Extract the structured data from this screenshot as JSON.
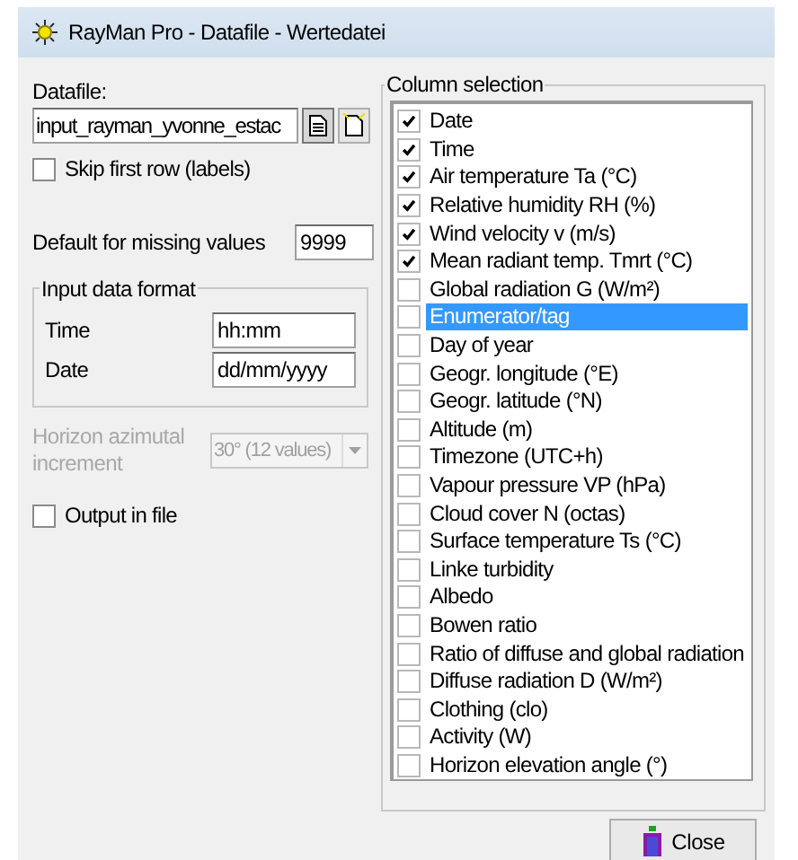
{
  "window": {
    "title": "RayMan Pro - Datafile - Wertedatei"
  },
  "datafile": {
    "label": "Datafile:",
    "value": "input_rayman_yvonne_estac"
  },
  "skip_first_row": {
    "label": "Skip first row (labels)",
    "checked": false
  },
  "missing_values": {
    "label": "Default for missing values",
    "value": "9999"
  },
  "input_format": {
    "title": "Input data format",
    "fields": [
      {
        "label": "Time",
        "value": "hh:mm"
      },
      {
        "label": "Date",
        "value": "dd/mm/yyyy"
      }
    ]
  },
  "horizon": {
    "label": "Horizon azimutal increment",
    "value": "30° (12 values)",
    "disabled": true
  },
  "output_in_file": {
    "label": "Output in file",
    "checked": false
  },
  "column_selection": {
    "title": "Column selection",
    "items": [
      {
        "label": "Date",
        "checked": true,
        "selected": false
      },
      {
        "label": "Time",
        "checked": true,
        "selected": false
      },
      {
        "label": "Air temperature Ta (°C)",
        "checked": true,
        "selected": false
      },
      {
        "label": "Relative humidity RH (%)",
        "checked": true,
        "selected": false
      },
      {
        "label": "Wind velocity v (m/s)",
        "checked": true,
        "selected": false
      },
      {
        "label": "Mean radiant temp. Tmrt (°C)",
        "checked": true,
        "selected": false
      },
      {
        "label": "Global radiation G (W/m²)",
        "checked": false,
        "selected": false
      },
      {
        "label": "Enumerator/tag",
        "checked": false,
        "selected": true
      },
      {
        "label": "Day of year",
        "checked": false,
        "selected": false
      },
      {
        "label": "Geogr. longitude (°E)",
        "checked": false,
        "selected": false
      },
      {
        "label": "Geogr. latitude (°N)",
        "checked": false,
        "selected": false
      },
      {
        "label": "Altitude (m)",
        "checked": false,
        "selected": false
      },
      {
        "label": "Timezone (UTC+h)",
        "checked": false,
        "selected": false
      },
      {
        "label": "Vapour pressure VP (hPa)",
        "checked": false,
        "selected": false
      },
      {
        "label": "Cloud cover N (octas)",
        "checked": false,
        "selected": false
      },
      {
        "label": "Surface temperature Ts (°C)",
        "checked": false,
        "selected": false
      },
      {
        "label": "Linke turbidity",
        "checked": false,
        "selected": false
      },
      {
        "label": "Albedo",
        "checked": false,
        "selected": false
      },
      {
        "label": "Bowen ratio",
        "checked": false,
        "selected": false
      },
      {
        "label": "Ratio of diffuse and global radiation",
        "checked": false,
        "selected": false
      },
      {
        "label": "Diffuse radiation D (W/m²)",
        "checked": false,
        "selected": false
      },
      {
        "label": "Clothing (clo)",
        "checked": false,
        "selected": false
      },
      {
        "label": "Activity (W)",
        "checked": false,
        "selected": false
      },
      {
        "label": "Horizon elevation angle (°)",
        "checked": false,
        "selected": false
      }
    ]
  },
  "close_button": {
    "label": "Close"
  }
}
